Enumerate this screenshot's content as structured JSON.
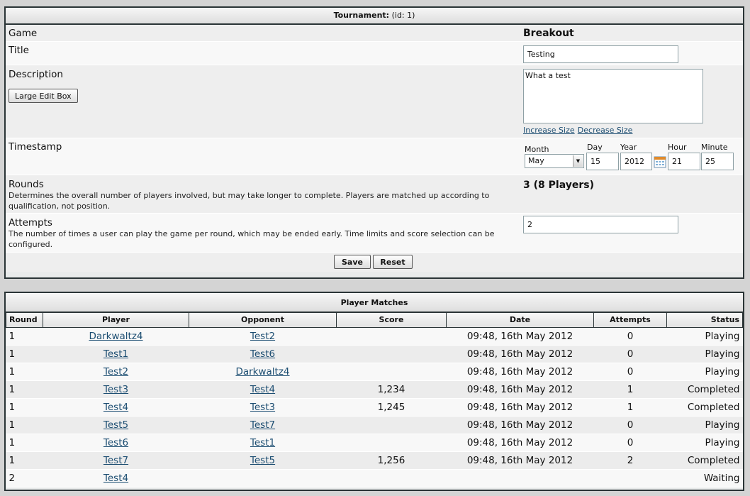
{
  "tournament": {
    "header_label": "Tournament:",
    "header_id": "(id: 1)",
    "game": {
      "label": "Game",
      "value": "Breakout"
    },
    "title": {
      "label": "Title",
      "value": "Testing"
    },
    "description": {
      "label": "Description",
      "large_edit_button": "Large Edit Box",
      "value": "What a test",
      "increase_link": "Increase Size",
      "decrease_link": "Decrease Size"
    },
    "timestamp": {
      "label": "Timestamp",
      "month_label": "Month",
      "month_value": "May",
      "day_label": "Day",
      "day_value": "15",
      "year_label": "Year",
      "year_value": "2012",
      "hour_label": "Hour",
      "hour_value": "21",
      "minute_label": "Minute",
      "minute_value": "25",
      "calendar_icon": "calendar-icon"
    },
    "rounds": {
      "label": "Rounds",
      "description": "Determines the overall number of players involved, but may take longer to complete. Players are matched up according to qualification, not position.",
      "value": "3 (8 Players)"
    },
    "attempts": {
      "label": "Attempts",
      "description": "The number of times a user can play the game per round, which may be ended early. Time limits and score selection can be configured.",
      "value": "2"
    },
    "save_button": "Save",
    "reset_button": "Reset"
  },
  "matches": {
    "title": "Player Matches",
    "columns": [
      "Round",
      "Player",
      "Opponent",
      "Score",
      "Date",
      "Attempts",
      "Status"
    ],
    "rows": [
      {
        "round": "1",
        "player": "Darkwaltz4",
        "opponent": "Test2",
        "score": "",
        "date": "09:48, 16th May 2012",
        "attempts": "0",
        "status": "Playing"
      },
      {
        "round": "1",
        "player": "Test1",
        "opponent": "Test6",
        "score": "",
        "date": "09:48, 16th May 2012",
        "attempts": "0",
        "status": "Playing"
      },
      {
        "round": "1",
        "player": "Test2",
        "opponent": "Darkwaltz4",
        "score": "",
        "date": "09:48, 16th May 2012",
        "attempts": "0",
        "status": "Playing"
      },
      {
        "round": "1",
        "player": "Test3",
        "opponent": "Test4",
        "score": "1,234",
        "date": "09:48, 16th May 2012",
        "attempts": "1",
        "status": "Completed"
      },
      {
        "round": "1",
        "player": "Test4",
        "opponent": "Test3",
        "score": "1,245",
        "date": "09:48, 16th May 2012",
        "attempts": "1",
        "status": "Completed"
      },
      {
        "round": "1",
        "player": "Test5",
        "opponent": "Test7",
        "score": "",
        "date": "09:48, 16th May 2012",
        "attempts": "0",
        "status": "Playing"
      },
      {
        "round": "1",
        "player": "Test6",
        "opponent": "Test1",
        "score": "",
        "date": "09:48, 16th May 2012",
        "attempts": "0",
        "status": "Playing"
      },
      {
        "round": "1",
        "player": "Test7",
        "opponent": "Test5",
        "score": "1,256",
        "date": "09:48, 16th May 2012",
        "attempts": "2",
        "status": "Completed"
      },
      {
        "round": "2",
        "player": "Test4",
        "opponent": "",
        "score": "",
        "date": "",
        "attempts": "",
        "status": "Waiting"
      }
    ]
  }
}
